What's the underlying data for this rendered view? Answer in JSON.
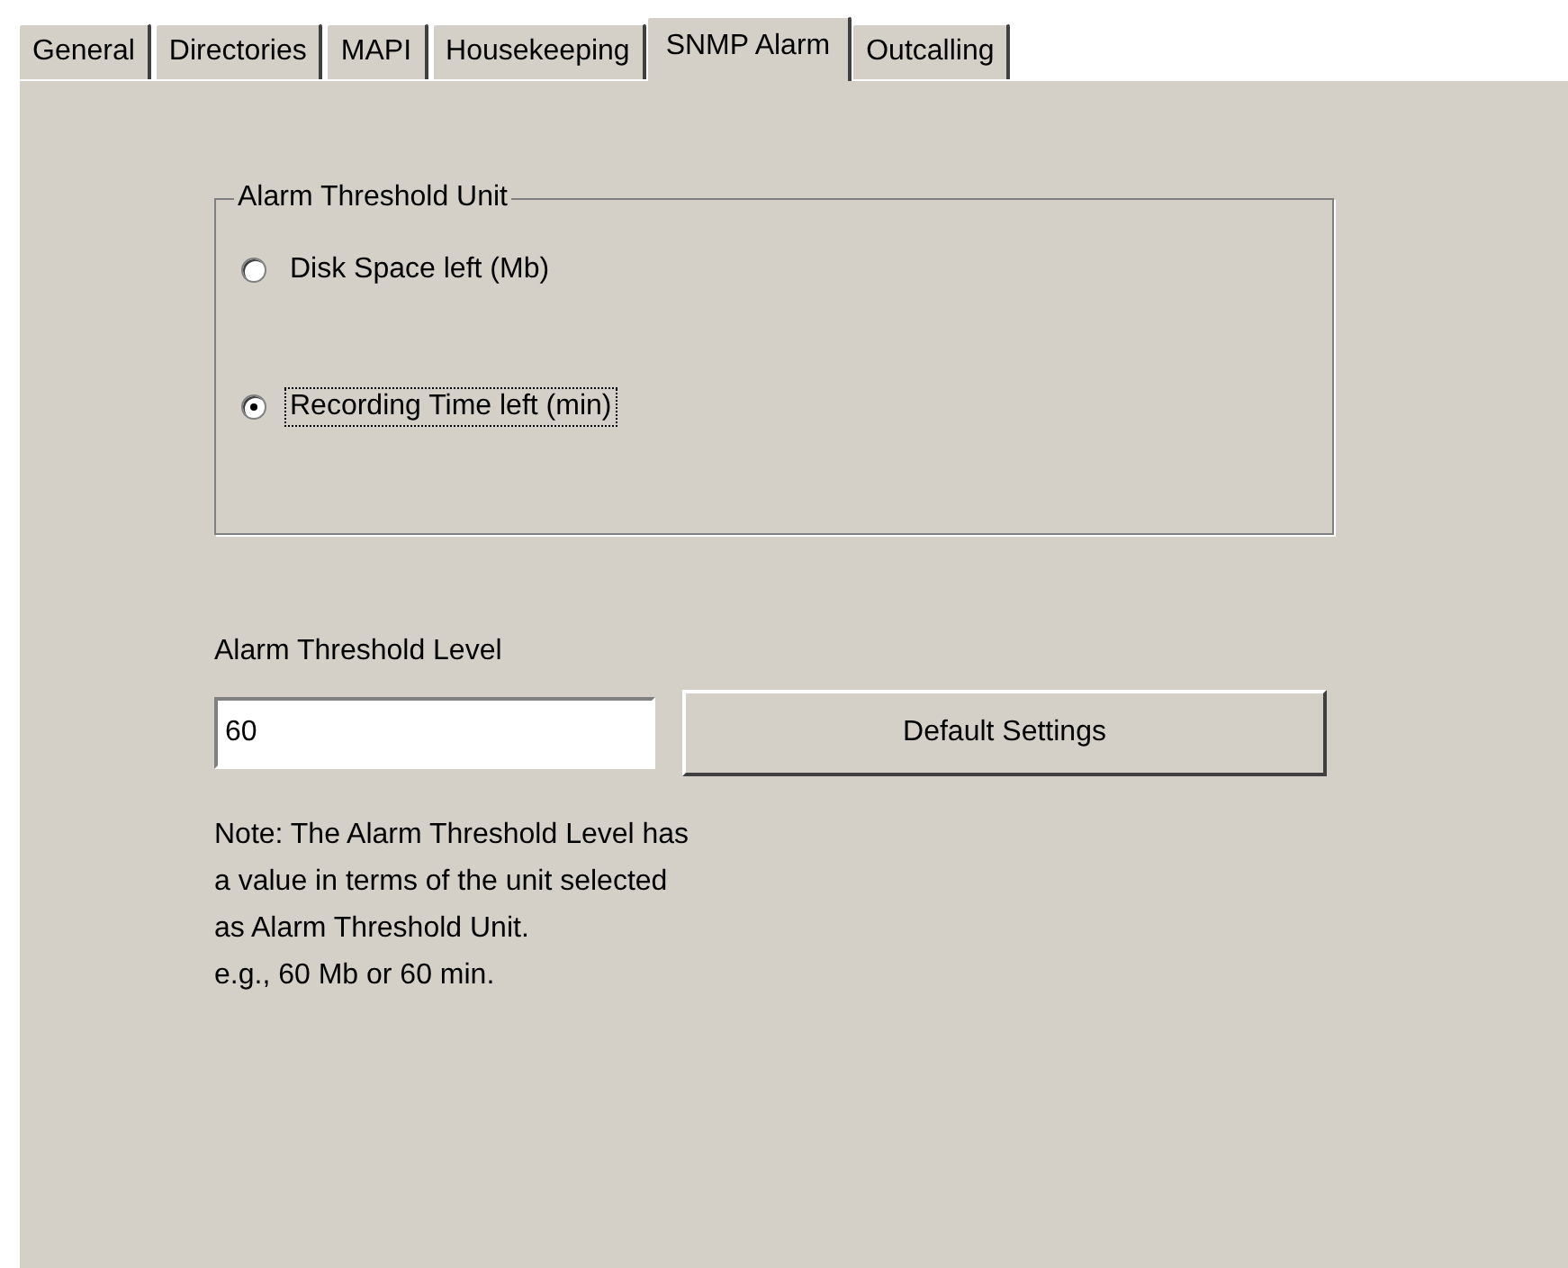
{
  "tabs": [
    {
      "label": "General",
      "selected": false
    },
    {
      "label": "Directories",
      "selected": false
    },
    {
      "label": "MAPI",
      "selected": false
    },
    {
      "label": "Housekeeping",
      "selected": false
    },
    {
      "label": "SNMP Alarm",
      "selected": true
    },
    {
      "label": "Outcalling",
      "selected": false
    }
  ],
  "unit_group": {
    "title": "Alarm Threshold Unit",
    "options": [
      {
        "label": "Disk Space left (Mb)",
        "selected": false
      },
      {
        "label": "Recording Time left (min)",
        "selected": true
      }
    ]
  },
  "level_label": "Alarm Threshold Level",
  "level_field": {
    "value": "60"
  },
  "default_button": "Default Settings",
  "note_lines": [
    "Note: The Alarm Threshold Level has",
    "a value in terms of the unit selected",
    "as Alarm Threshold Unit.",
    "e.g., 60 Mb or 60 min."
  ]
}
